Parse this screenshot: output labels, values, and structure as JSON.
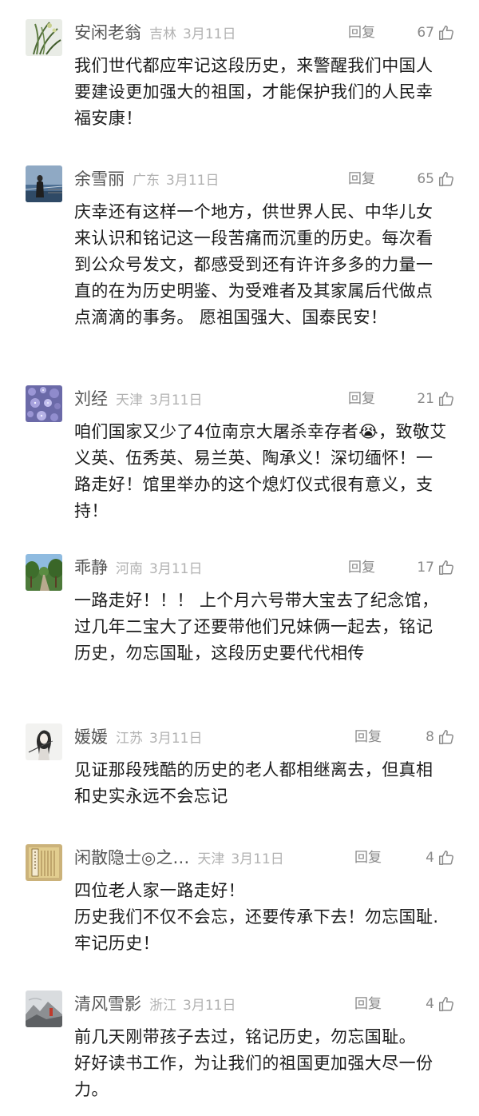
{
  "comments": [
    {
      "user": "安闲老翁",
      "region": "吉林",
      "date": "3月11日",
      "reply_label": "回复",
      "likes": "67",
      "avatar_icon": "orchid-plant-avatar",
      "text": [
        "我们世代都应牢记这段历史，来警醒我们中国人要建设更加强大的祖国，才能保护我们的人民幸福安康！"
      ]
    },
    {
      "user": "余雪丽",
      "region": "广东",
      "date": "3月11日",
      "reply_label": "回复",
      "likes": "65",
      "avatar_icon": "person-by-sea-avatar",
      "text": [
        "庆幸还有这样一个地方，供世界人民、中华儿女来认识和铭记这一段苦痛而沉重的历史。每次看到公众号发文，都感受到还有许许多多的力量一直的在为历史明鉴、为受难者及其家属后代做点点滴滴的事务。 愿祖国强大、国泰民安！"
      ]
    },
    {
      "user": "刘经",
      "region": "天津",
      "date": "3月11日",
      "reply_label": "回复",
      "likes": "21",
      "avatar_icon": "purple-flowers-avatar",
      "text": [
        "咱们国家又少了4位南京大屠杀幸存者😭，致敬艾义英、伍秀英、易兰英、陶承义！深切缅怀！一路走好！馆里举办的这个熄灯仪式很有意义，支持！"
      ]
    },
    {
      "user": "乖静",
      "region": "河南",
      "date": "3月11日",
      "reply_label": "回复",
      "likes": "17",
      "avatar_icon": "tree-lined-road-avatar",
      "text": [
        "一路走好！！！ 上个月六号带大宝去了纪念馆，过几年二宝大了还要带他们兄妹俩一起去，铭记历史，勿忘国耻，这段历史要代代相传"
      ]
    },
    {
      "user": "媛媛",
      "region": "江苏",
      "date": "3月11日",
      "reply_label": "回复",
      "likes": "8",
      "avatar_icon": "sketched-girl-avatar",
      "text": [
        "见证那段残酷的历史的老人都相继离去，但真相和史实永远不会忘记"
      ]
    },
    {
      "user": "闲散隐士◎之…",
      "region": "天津",
      "date": "3月11日",
      "reply_label": "回复",
      "likes": "4",
      "avatar_icon": "ancient-book-avatar",
      "text": [
        "四位老人家一路走好！",
        "历史我们不仅不会忘，还要传承下去！勿忘国耻.牢记历史！"
      ]
    },
    {
      "user": "清风雪影",
      "region": "浙江",
      "date": "3月11日",
      "reply_label": "回复",
      "likes": "4",
      "avatar_icon": "landscape-photo-avatar",
      "text": [
        "前几天刚带孩子去过，铭记历史，勿忘国耻。",
        "好好读书工作，为让我们的祖国更加强大尽一份力。"
      ]
    }
  ]
}
